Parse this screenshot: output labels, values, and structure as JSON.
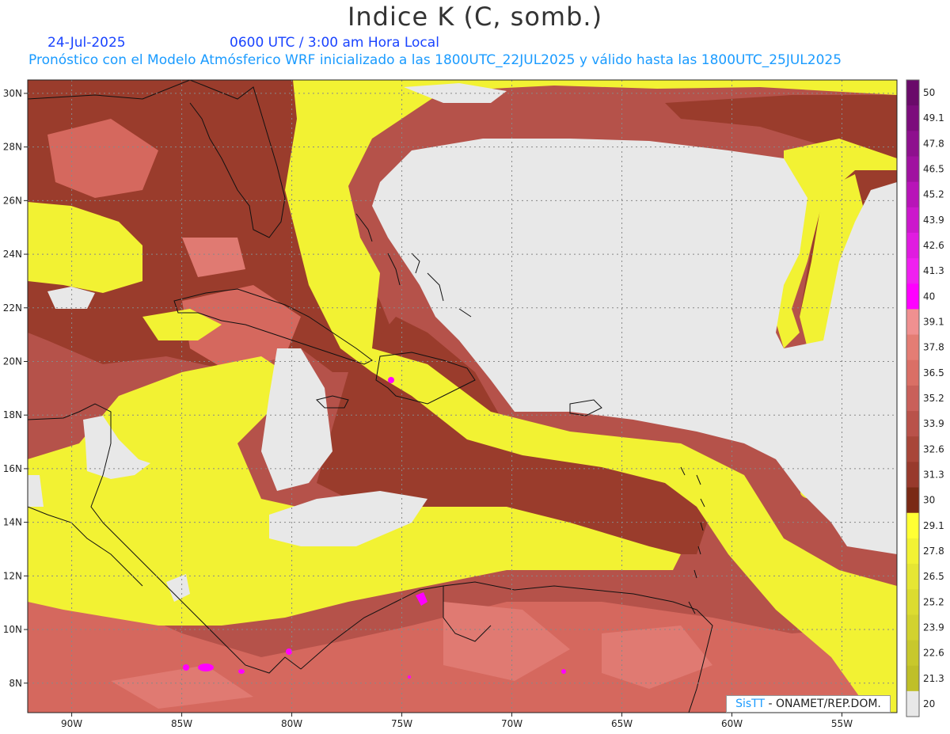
{
  "header": {
    "title": "Indice K (C, somb.)",
    "date": "24-Jul-2025",
    "time": "0600 UTC / 3:00 am Hora Local",
    "model_line": "Pronóstico con el Modelo Atmósferico WRF inicializado a las 1800UTC_22JUL2025 y válido hasta las  1800UTC_25JUL2025"
  },
  "map": {
    "lat_labels": [
      "30N",
      "28N",
      "26N",
      "24N",
      "22N",
      "20N",
      "18N",
      "16N",
      "14N",
      "12N",
      "10N",
      "8N"
    ],
    "lon_labels": [
      "90W",
      "85W",
      "80W",
      "75W",
      "70W",
      "65W",
      "60W",
      "55W"
    ],
    "lats": [
      30,
      28,
      26,
      24,
      22,
      20,
      18,
      16,
      14,
      12,
      10,
      8
    ],
    "lons": [
      -90,
      -85,
      -80,
      -75,
      -70,
      -65,
      -60,
      -55
    ],
    "lon_range": [
      -92,
      -52.5
    ],
    "lat_range": [
      6.9,
      30.5
    ]
  },
  "colorbar": {
    "labels": [
      "50",
      "49.1",
      "47.8",
      "46.5",
      "45.2",
      "43.9",
      "42.6",
      "41.3",
      "40",
      "39.1",
      "37.8",
      "36.5",
      "35.2",
      "33.9",
      "32.6",
      "31.3",
      "30",
      "29.1",
      "27.8",
      "26.5",
      "25.2",
      "23.9",
      "22.6",
      "21.3",
      "20"
    ],
    "colors": [
      "#6a0a6a",
      "#7c0c7c",
      "#8e108e",
      "#a012a0",
      "#b814b8",
      "#cc18cc",
      "#e01ce0",
      "#f020f0",
      "#ff00ff",
      "#f09090",
      "#e47d74",
      "#da6f66",
      "#c9605a",
      "#b9524a",
      "#a84639",
      "#983a2c",
      "#7a2a15",
      "#ffff33",
      "#f2f233",
      "#e6e633",
      "#dcdc30",
      "#d2d22e",
      "#c8c82c",
      "#bfbf28",
      "#e8e8e8"
    ]
  },
  "colors": {
    "no_data": "#e8e8e8",
    "yellow": "#f2f233",
    "dark_red": "#9a3c2c",
    "mid_red": "#b5524a",
    "light_red": "#d5685e",
    "pink": "#e07a72",
    "magenta": "#ff00ff"
  },
  "credit": {
    "sis": "SisTT",
    "org": " - ONAMET/REP.DOM."
  }
}
